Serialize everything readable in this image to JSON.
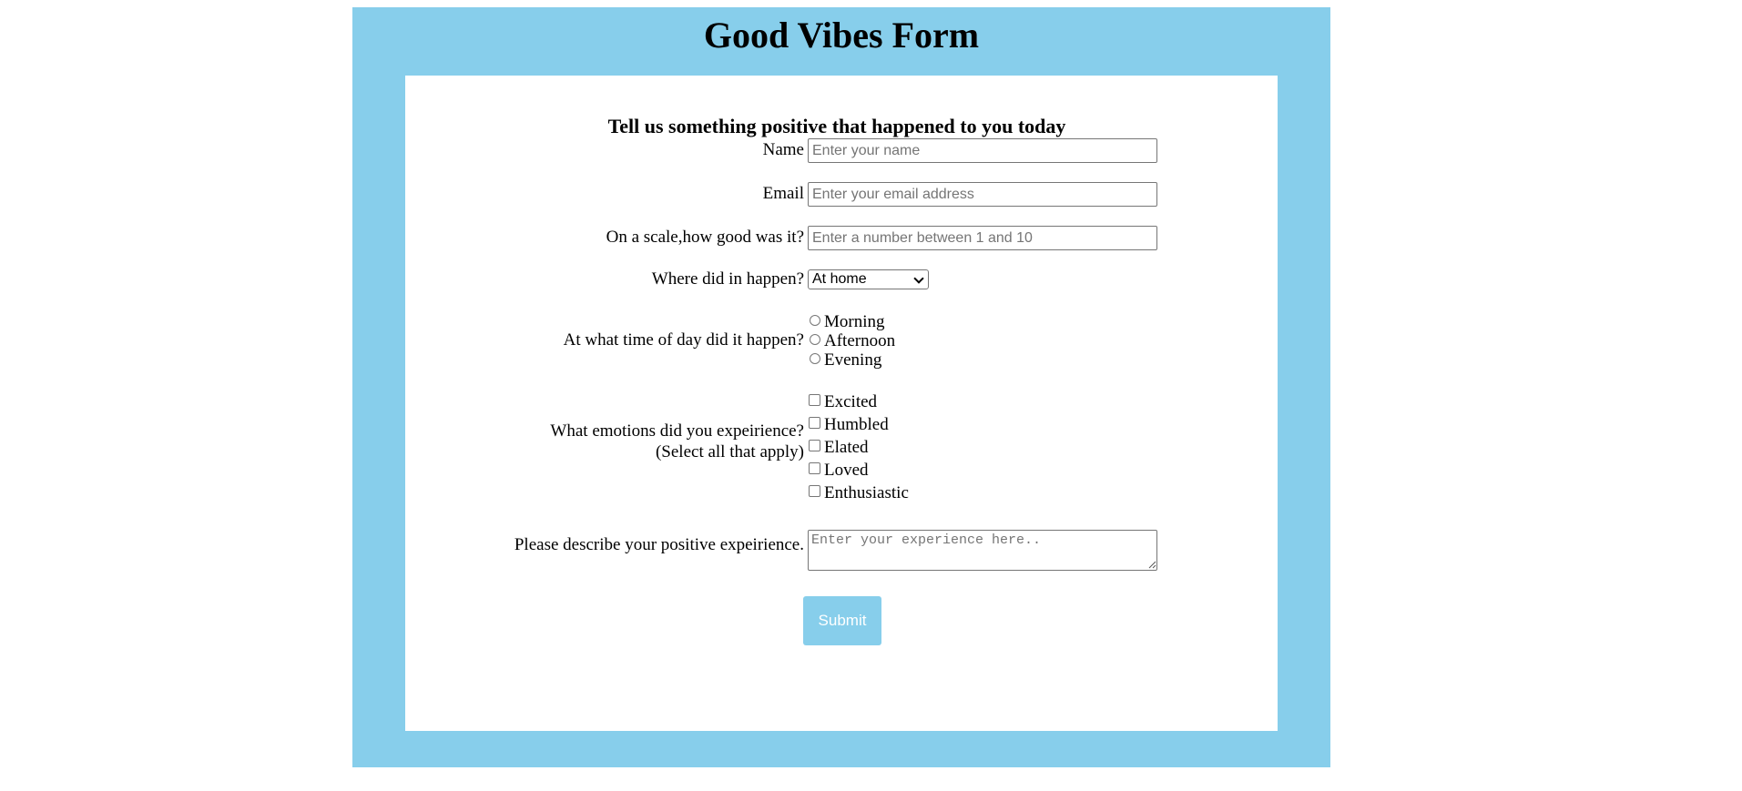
{
  "page": {
    "title": "Good Vibes Form"
  },
  "form": {
    "subtitle": "Tell us something positive that happened to you today",
    "name": {
      "label": "Name",
      "placeholder": "Enter your name",
      "value": ""
    },
    "email": {
      "label": "Email",
      "placeholder": "Enter your email address",
      "value": ""
    },
    "scale": {
      "label": "On a scale,how good was it?",
      "placeholder": "Enter a number between 1 and 10",
      "value": ""
    },
    "location": {
      "label": "Where did in happen?",
      "selected": "At home"
    },
    "time_of_day": {
      "label": "At what time of day did it happen?",
      "options": [
        "Morning",
        "Afternoon",
        "Evening"
      ]
    },
    "emotions": {
      "label_line1": "What emotions did you expeirience?",
      "label_line2": "(Select all that apply)",
      "options": [
        "Excited",
        "Humbled",
        "Elated",
        "Loved",
        "Enthusiastic"
      ]
    },
    "description": {
      "label": "Please describe your positive expeirience.",
      "placeholder": "Enter your experience here..",
      "value": ""
    },
    "submit_label": "Submit"
  },
  "colors": {
    "frame_background": "#87ceeb",
    "card_background": "#ffffff",
    "submit_background": "#87ceeb",
    "submit_text": "#ffffff"
  }
}
